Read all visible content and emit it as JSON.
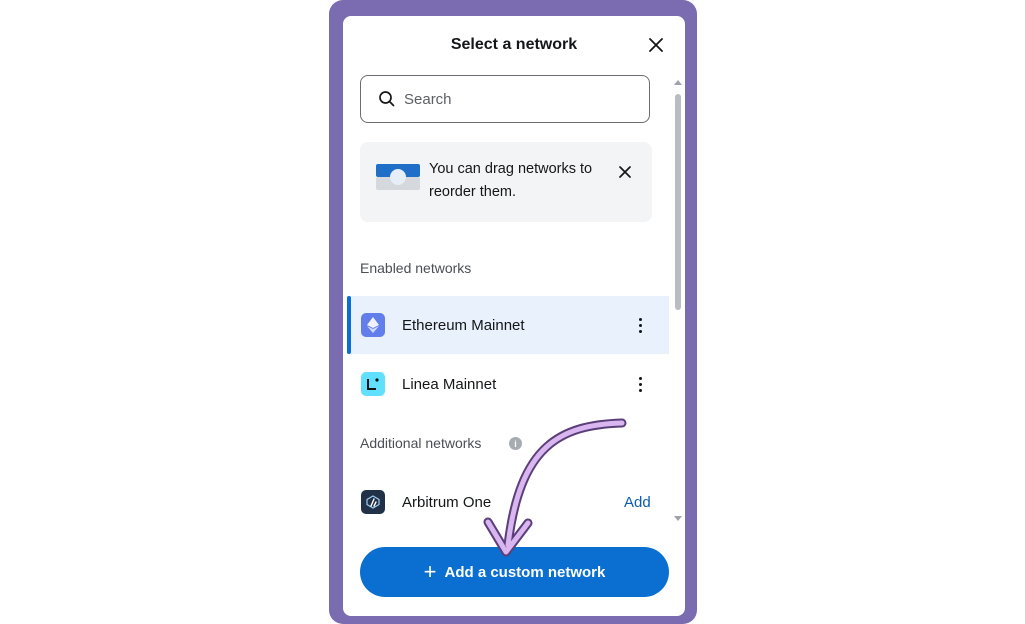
{
  "modal": {
    "title": "Select a network",
    "close_icon": "close-icon"
  },
  "search": {
    "placeholder": "Search",
    "value": "",
    "icon": "search-icon"
  },
  "banner": {
    "text": "You can drag networks to reorder them.",
    "close_icon": "close-icon"
  },
  "enabled_section": {
    "label": "Enabled networks",
    "items": [
      {
        "name": "Ethereum Mainnet",
        "icon": "ethereum-icon",
        "selected": true,
        "menu_icon": "kebab-menu-icon"
      },
      {
        "name": "Linea Mainnet",
        "icon": "linea-icon",
        "selected": false,
        "menu_icon": "kebab-menu-icon"
      }
    ]
  },
  "additional_section": {
    "label": "Additional networks",
    "info_icon": "info-icon",
    "items": [
      {
        "name": "Arbitrum One",
        "icon": "arbitrum-icon",
        "action_label": "Add"
      }
    ]
  },
  "footer": {
    "add_custom_label": "Add a custom network",
    "plus_glyph": "+"
  },
  "colors": {
    "frame": "#7b6bb0",
    "accent": "#0a6fd1",
    "selected_row": "#e8f1fc",
    "link": "#0a5cb3",
    "annotation_arrow": "#d9b6ef"
  }
}
